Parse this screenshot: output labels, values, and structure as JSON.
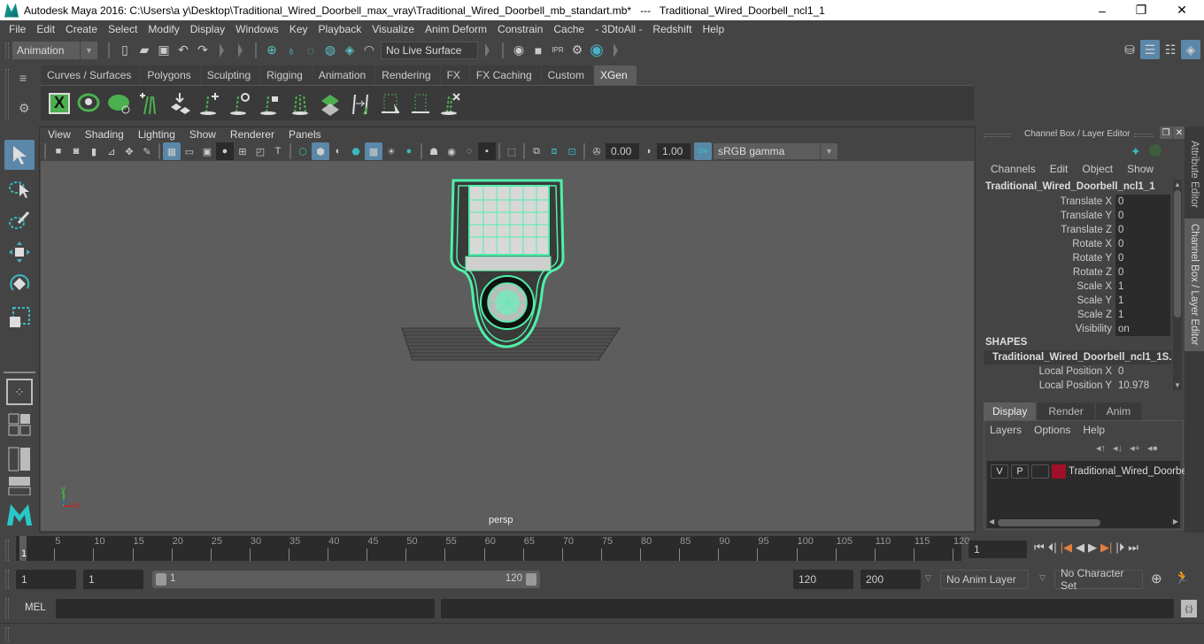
{
  "window": {
    "title": "Autodesk Maya 2016: C:\\Users\\a y\\Desktop\\Traditional_Wired_Doorbell_max_vray\\Traditional_Wired_Doorbell_mb_standart.mb*   ---   Traditional_Wired_Doorbell_ncl1_1",
    "minimize": "–",
    "restore": "❐",
    "close": "✕"
  },
  "menubar": [
    "File",
    "Edit",
    "Create",
    "Select",
    "Modify",
    "Display",
    "Windows",
    "Key",
    "Playback",
    "Visualize",
    "Anim Deform",
    "Constrain",
    "Cache",
    "- 3DtoAll -",
    "Redshift",
    "Help"
  ],
  "statusline": {
    "menuset": "Animation",
    "live_surface": "No Live Surface"
  },
  "shelf": {
    "tabs": [
      "Curves / Surfaces",
      "Polygons",
      "Sculpting",
      "Rigging",
      "Animation",
      "Rendering",
      "FX",
      "FX Caching",
      "Custom",
      "XGen"
    ],
    "active_tab": "XGen"
  },
  "viewport_panel": {
    "menu": [
      "View",
      "Shading",
      "Lighting",
      "Show",
      "Renderer",
      "Panels"
    ],
    "exposure": "0.00",
    "gamma": "1.00",
    "color_mgmt_toggle": "ON",
    "color_space": "sRGB gamma",
    "camera_label": "persp",
    "axis": {
      "x": "x",
      "y": "y",
      "z": "z"
    }
  },
  "channel_box": {
    "title": "Channel Box / Layer Editor",
    "menu": [
      "Channels",
      "Edit",
      "Object",
      "Show"
    ],
    "object_name": "Traditional_Wired_Doorbell_ncl1_1",
    "channels": [
      {
        "label": "Translate X",
        "value": "0"
      },
      {
        "label": "Translate Y",
        "value": "0"
      },
      {
        "label": "Translate Z",
        "value": "0"
      },
      {
        "label": "Rotate X",
        "value": "0"
      },
      {
        "label": "Rotate Y",
        "value": "0"
      },
      {
        "label": "Rotate Z",
        "value": "0"
      },
      {
        "label": "Scale X",
        "value": "1"
      },
      {
        "label": "Scale Y",
        "value": "1"
      },
      {
        "label": "Scale Z",
        "value": "1"
      },
      {
        "label": "Visibility",
        "value": "on"
      }
    ],
    "shapes_header": "SHAPES",
    "shape_name": "Traditional_Wired_Doorbell_ncl1_1S...",
    "shape_channels": [
      {
        "label": "Local Position X",
        "value": "0"
      },
      {
        "label": "Local Position Y",
        "value": "10.978"
      }
    ]
  },
  "layer_editor": {
    "tabs": [
      "Display",
      "Render",
      "Anim"
    ],
    "active_tab": "Display",
    "menu": [
      "Layers",
      "Options",
      "Help"
    ],
    "layers": [
      {
        "v": "V",
        "p": "P",
        "color": "#a0102a",
        "name": "Traditional_Wired_Doorbell"
      }
    ]
  },
  "side_tabs": [
    "Attribute Editor",
    "Channel Box / Layer Editor"
  ],
  "timeline": {
    "ticks": [
      5,
      10,
      15,
      20,
      25,
      30,
      35,
      40,
      45,
      50,
      55,
      60,
      65,
      70,
      75,
      80,
      85,
      90,
      95,
      100,
      105,
      110,
      115,
      120
    ],
    "start": 1,
    "end": 120,
    "current_frame_marker": "1",
    "current_frame": "1"
  },
  "range": {
    "start_time": "1",
    "playback_start": "1",
    "slider_min": "1",
    "slider_max": "120",
    "playback_end": "120",
    "end_time": "200",
    "anim_layer": "No Anim Layer",
    "character_set": "No Character Set"
  },
  "command_line": {
    "language": "MEL",
    "input": "",
    "result": ""
  },
  "colors": {
    "accent_blue": "#5b87a8",
    "wire_green": "#4ef0a8",
    "keyframe_orange": "#e08040",
    "layer_red": "#a0102a"
  }
}
